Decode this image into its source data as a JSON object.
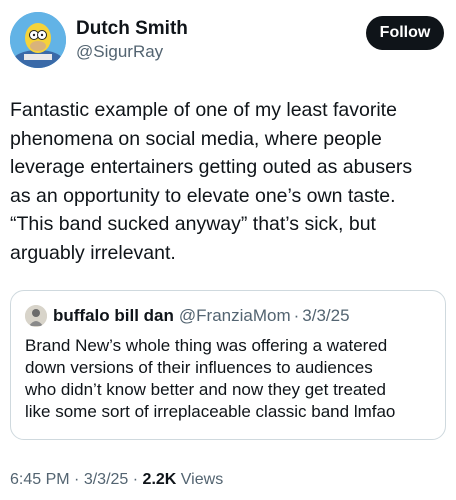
{
  "author": {
    "display_name": "Dutch Smith",
    "handle": "@SigurRay",
    "avatar_icon": "cartoon-character-avatar"
  },
  "follow_label": "Follow",
  "tweet_text": "Fantastic example of one of my least favorite\nphenomena on social media, where people\nleverage entertainers getting outed as abusers\nas an opportunity to elevate one’s own taste.\n“This band sucked anyway” that’s sick, but\narguably irrelevant.",
  "quoted": {
    "display_name": "buffalo bill dan",
    "handle": "@FranziaMom",
    "separator": "·",
    "date": "3/3/25",
    "text": "Brand New’s whole thing was offering a watered\ndown versions of their influences to audiences\nwho didn’t know better and now they get treated\nlike some sort of irreplaceable classic band lmfao"
  },
  "meta": {
    "time": "6:45 PM",
    "separator": "·",
    "date": "3/3/25",
    "views_count": "2.2K",
    "views_label": "Views"
  },
  "colors": {
    "text": "#0f1419",
    "secondary": "#536471",
    "border": "#cfd9de",
    "button": "#0f1419"
  }
}
